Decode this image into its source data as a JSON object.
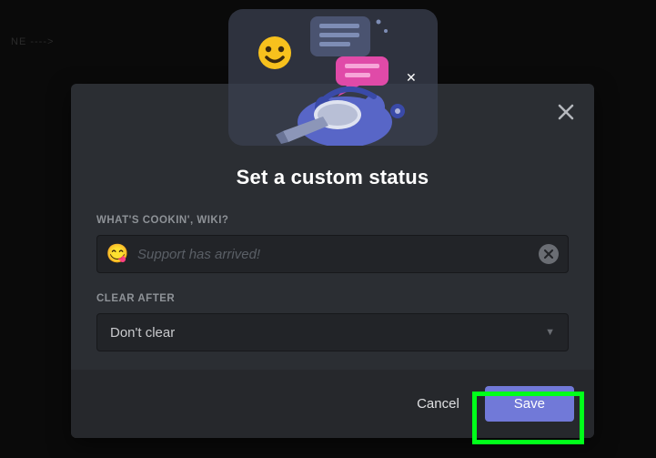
{
  "backdrop": {
    "left_text": "NE ---->"
  },
  "modal": {
    "title": "Set a custom status",
    "status_label": "WHAT'S COOKIN', WIKI?",
    "status_emoji": "😋",
    "status_placeholder": "Support has arrived!",
    "status_value": "",
    "clear_after_label": "CLEAR AFTER",
    "clear_after_value": "Don't clear",
    "cancel_label": "Cancel",
    "save_label": "Save"
  }
}
